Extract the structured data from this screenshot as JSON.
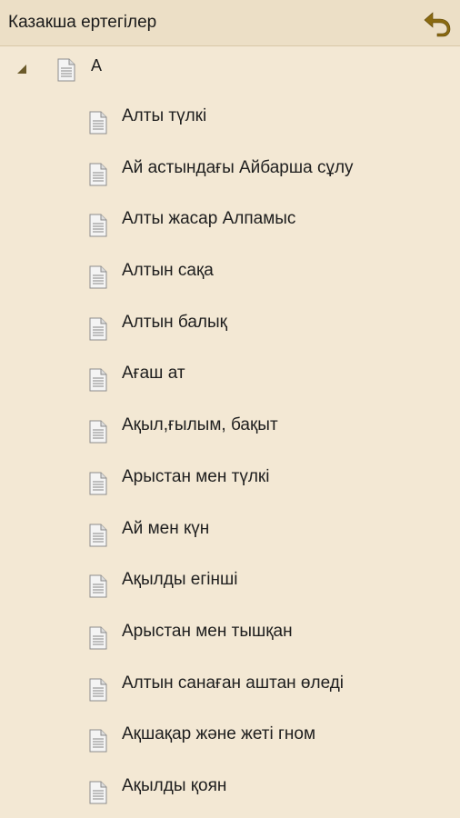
{
  "app": {
    "title": "Казакша ертегілер",
    "back_icon": "back-arrow-icon",
    "accent_color": "#8a6a10"
  },
  "tree": {
    "group": {
      "label": "А",
      "expanded": true,
      "icon": "document-icon"
    },
    "items": [
      {
        "label": "Алты түлкі"
      },
      {
        "label": "Ай астындағы Айбарша сұлу"
      },
      {
        "label": "Алты жасар Алпамыс"
      },
      {
        "label": "Алтын сақа"
      },
      {
        "label": "Алтын балық"
      },
      {
        "label": "Ағаш ат"
      },
      {
        "label": "Ақыл,ғылым, бақыт"
      },
      {
        "label": "Арыстан мен түлкі"
      },
      {
        "label": "Ай мен күн"
      },
      {
        "label": "Ақылды егінші"
      },
      {
        "label": "Арыстан мен тышқан"
      },
      {
        "label": "Алтын санаған аштан өледі"
      },
      {
        "label": "Ақшақар және жеті гном"
      },
      {
        "label": "Ақылды қоян"
      }
    ]
  }
}
